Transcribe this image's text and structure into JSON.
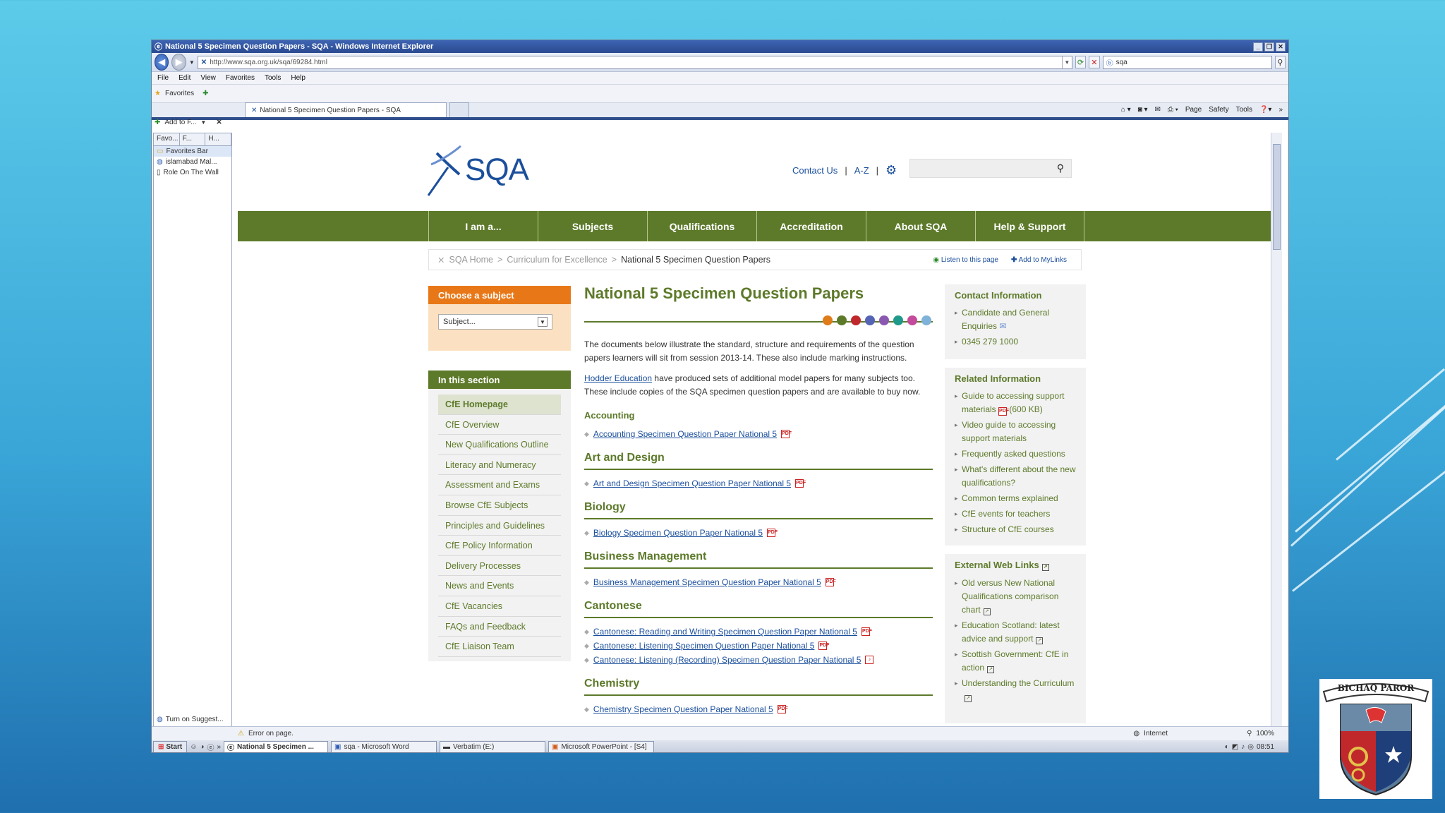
{
  "window": {
    "title": "National 5 Specimen Question Papers - SQA - Windows Internet Explorer"
  },
  "browser": {
    "address": "http://www.sqa.org.uk/sqa/69284.html",
    "search_value": "sqa",
    "menu": [
      "File",
      "Edit",
      "View",
      "Favorites",
      "Tools",
      "Help"
    ],
    "favorites_label": "Favorites",
    "tab_label": "National 5 Specimen Question Papers - SQA",
    "cmd": {
      "page": "Page",
      "safety": "Safety",
      "tools": "Tools"
    },
    "addto": "Add to F...",
    "sidebar_tabs": [
      "Favo...",
      "F...",
      "H..."
    ],
    "sidebar_items": [
      "Favorites Bar",
      "islamabad Mal...",
      "Role On The Wall"
    ],
    "turn_on": "Turn on Suggest...",
    "status_text": "Error on page.",
    "zone": "Internet",
    "zoom": "100%"
  },
  "taskbar": {
    "start": "Start",
    "items": [
      "National 5 Specimen ...",
      "sqa - Microsoft Word",
      "Verbatim (E:)",
      "Microsoft PowerPoint - [S4]"
    ],
    "clock": "08:51"
  },
  "site": {
    "logo_text": "SQA",
    "toplinks": {
      "contact": "Contact Us",
      "az": "A-Z"
    },
    "nav": [
      "I am a...",
      "Subjects",
      "Qualifications",
      "Accreditation",
      "About SQA",
      "Help & Support"
    ],
    "breadcrumb": {
      "home": "SQA Home",
      "parent": "Curriculum for Excellence",
      "current": "National 5 Specimen Question Papers",
      "listen": "Listen to this page",
      "mylinks": "Add to MyLinks"
    },
    "chooser": {
      "title": "Choose a subject",
      "placeholder": "Subject..."
    },
    "in_section": {
      "title": "In this section",
      "items": [
        "CfE Homepage",
        "CfE Overview",
        "New Qualifications Outline",
        "Literacy and Numeracy",
        "Assessment and Exams",
        "Browse CfE Subjects",
        "Principles and Guidelines",
        "CfE Policy Information",
        "Delivery Processes",
        "News and Events",
        "CfE Vacancies",
        "FAQs and Feedback",
        "CfE Liaison Team"
      ]
    },
    "main": {
      "title": "National 5 Specimen Question Papers",
      "dot_colors": [
        "#e07b1a",
        "#5d7a2a",
        "#c0282c",
        "#5564b4",
        "#8a58b0",
        "#1f9a8a",
        "#c44a9c",
        "#7fb2d8"
      ],
      "intro": "The documents below illustrate the standard, structure and requirements of the question papers learners will sit from session 2013-14. These also include marking instructions.",
      "hodder_link": "Hodder Education",
      "hodder_text": " have produced sets of additional model papers for many subjects too. These include copies of the SQA specimen question papers and are available to buy now.",
      "accounting_head": "Accounting",
      "accounting_doc": "Accounting Specimen Question Paper National 5",
      "art_head": "Art and Design",
      "art_doc": "Art and Design Specimen Question Paper National 5",
      "bio_head": "Biology",
      "bio_doc": "Biology Specimen Question Paper National 5",
      "bm_head": "Business Management",
      "bm_doc": "Business Management Specimen Question Paper National 5",
      "cant_head": "Cantonese",
      "cant_docs": [
        "Cantonese: Reading and Writing Specimen Question Paper National 5",
        "Cantonese: Listening Specimen Question Paper National 5",
        "Cantonese: Listening (Recording) Specimen Question Paper National 5"
      ],
      "chem_head": "Chemistry",
      "chem_doc": "Chemistry Specimen Question Paper National 5"
    },
    "contact": {
      "title": "Contact Information",
      "items": [
        "Candidate and General Enquiries",
        "0345 279 1000"
      ]
    },
    "related": {
      "title": "Related Information",
      "items": [
        "Guide to accessing support materials",
        "(600 KB)",
        "Video guide to accessing support materials",
        "Frequently asked questions",
        "What's different about the new qualifications?",
        "Common terms explained",
        "CfE events for teachers",
        "Structure of CfE courses"
      ]
    },
    "external": {
      "title": "External Web Links",
      "items": [
        "Old versus New National Qualifications comparison chart",
        "Education Scotland: latest advice and support",
        "Scottish Government: CfE in action",
        "Understanding the Curriculum"
      ]
    }
  },
  "crest": {
    "motto": "BICHAQ PAROR"
  }
}
